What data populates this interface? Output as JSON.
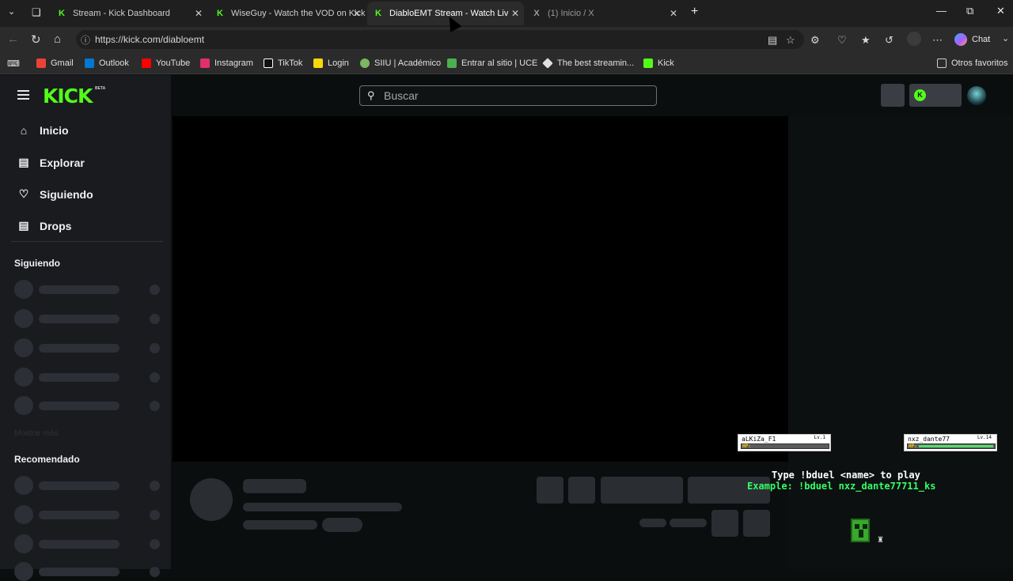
{
  "browser": {
    "tabs": [
      {
        "title": "Stream - Kick Dashboard",
        "favicon": "kick-icon"
      },
      {
        "title": "WiseGuy - Watch the VOD on Kick",
        "favicon": "kick-icon"
      },
      {
        "title": "DiabloEMT Stream - Watch Live on",
        "favicon": "kick-icon",
        "active": true
      },
      {
        "title": "(1) Inicio / X",
        "favicon": "x-icon"
      }
    ],
    "url": "https://kick.com/diabloemt",
    "chat_label": "Chat",
    "bookmarks": [
      {
        "label": "Gmail",
        "icon": "gmail-icon",
        "color": "#ea4335"
      },
      {
        "label": "Outlook",
        "icon": "outlook-icon",
        "color": "#0078d4"
      },
      {
        "label": "YouTube",
        "icon": "youtube-icon",
        "color": "#ff0000"
      },
      {
        "label": "Instagram",
        "icon": "instagram-icon",
        "color": "#e1306c"
      },
      {
        "label": "TikTok",
        "icon": "tiktok-icon",
        "color": "#ffffff"
      },
      {
        "label": "Login",
        "icon": "login-icon",
        "color": "#f5d90a"
      },
      {
        "label": "SIIU | Académico",
        "icon": "siiu-icon",
        "color": "#7bb661"
      },
      {
        "label": "Entrar al sitio | UCE",
        "icon": "uce-icon",
        "color": "#4caf50"
      },
      {
        "label": "The best streamin...",
        "icon": "stream-icon",
        "color": "#e0e0e0"
      },
      {
        "label": "Kick",
        "icon": "kick-icon",
        "color": "#53fc18"
      }
    ],
    "other_favorites": "Otros favoritos"
  },
  "kick": {
    "brand_color": "#53fc18",
    "logo": "KICK",
    "logo_badge": "BETA",
    "nav": [
      {
        "label": "Inicio",
        "icon": "home-icon"
      },
      {
        "label": "Explorar",
        "icon": "compass-icon"
      },
      {
        "label": "Siguiendo",
        "icon": "heart-icon"
      },
      {
        "label": "Drops",
        "icon": "drops-icon"
      }
    ],
    "following_heading": "Siguiendo",
    "show_more": "Mostrar más",
    "recommended_heading": "Recomendado",
    "search_placeholder": "Buscar"
  },
  "overlay": {
    "player1": {
      "name": "aLKiZa_F1",
      "level": "Lv.1",
      "hp_label": "HP:",
      "hp": 0.0
    },
    "player2": {
      "name": "nxz_dante77",
      "level": "Lv.14",
      "hp_label": "HP:",
      "hp": 1.0
    },
    "instruction": "Type !bduel <name> to play",
    "example": "Example: !bduel nxz_dante77711_ks"
  }
}
